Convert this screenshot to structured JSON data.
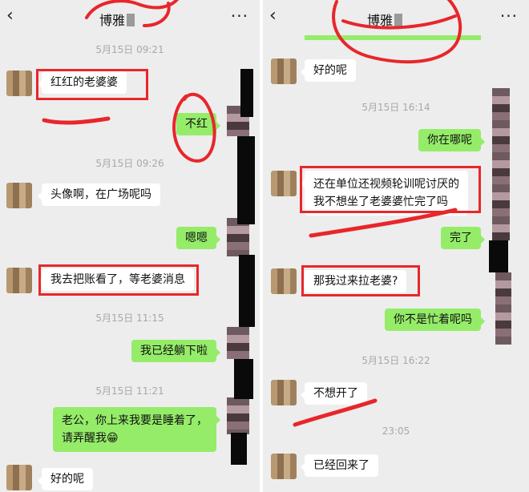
{
  "left": {
    "header": {
      "back_icon": "‹",
      "title": "博雅",
      "more_icon": "···"
    },
    "timestamps": [
      "5月15日 09:21",
      "5月15日 09:26",
      "5月15日 11:15",
      "5月15日 11:21"
    ],
    "messages": [
      {
        "text": "红红的老婆婆",
        "side": "in"
      },
      {
        "text": "不红",
        "side": "out"
      },
      {
        "text": "头像啊，在广场呢吗",
        "side": "in"
      },
      {
        "text": "嗯嗯",
        "side": "out"
      },
      {
        "text": "我去把账看了，等老婆消息",
        "side": "in"
      },
      {
        "text": "我已经躺下啦",
        "side": "out"
      },
      {
        "line1": "老公，你上来我要是睡着了，",
        "line2": "请弄醒我😁",
        "side": "out"
      },
      {
        "text": "好的呢",
        "side": "in"
      }
    ]
  },
  "right": {
    "header": {
      "back_icon": "‹",
      "title": "博雅",
      "more_icon": "···"
    },
    "timestamps": [
      "5月15日 16:14",
      "5月15日 16:22",
      "23:05"
    ],
    "messages": [
      {
        "text": "好的呢",
        "side": "in"
      },
      {
        "text": "你在哪呢",
        "side": "out"
      },
      {
        "line1": "还在单位还视频轮训呢讨厌的",
        "line2": "我不想坐了老婆婆忙完了吗",
        "side": "in"
      },
      {
        "text": "完了",
        "side": "out"
      },
      {
        "text": "那我过来拉老婆?",
        "side": "in"
      },
      {
        "text": "你不是忙着呢吗",
        "side": "out"
      },
      {
        "text": "不想开了",
        "side": "in"
      },
      {
        "text": "已经回来了",
        "side": "in"
      }
    ]
  }
}
